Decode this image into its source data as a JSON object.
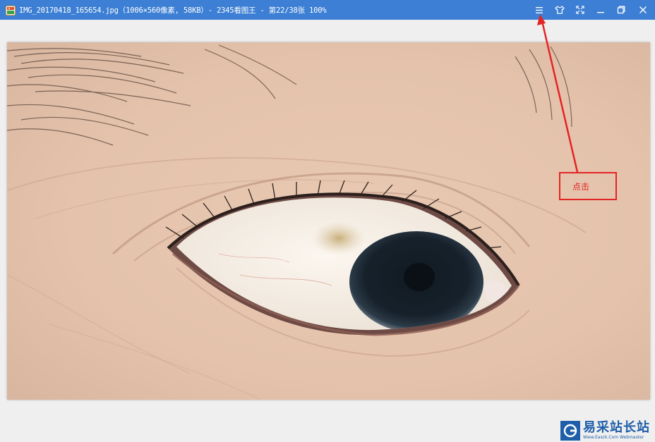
{
  "window": {
    "title": "IMG_20170418_165654.jpg（1006×560像素, 58KB）- 2345看图王 - 第22/38张 100%"
  },
  "titlebar_icons": [
    "app-icon",
    "menu-icon",
    "skin-icon",
    "fullscreen-icon",
    "minimize-icon",
    "restore-icon",
    "close-icon"
  ],
  "annotation": {
    "label": "点击",
    "color": "#e42424"
  },
  "watermark": {
    "name": "易采站长站",
    "url": "Www.Easck.Com Webmaster"
  },
  "colors": {
    "titlebar": "#3c7fd4",
    "background": "#efefef",
    "annotation": "#e42424",
    "watermark": "#1f5fa9"
  }
}
